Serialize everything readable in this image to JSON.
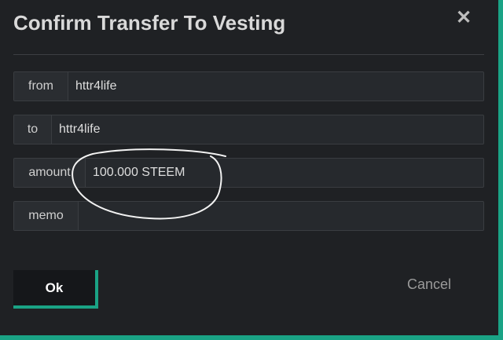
{
  "dialog": {
    "title": "Confirm Transfer To Vesting",
    "close_glyph": "✕"
  },
  "fields": {
    "from": {
      "label": "from",
      "value": "httr4life"
    },
    "to": {
      "label": "to",
      "value": "httr4life"
    },
    "amount": {
      "label": "amount",
      "value": "100.000 STEEM"
    },
    "memo": {
      "label": "memo",
      "value": ""
    }
  },
  "actions": {
    "ok_label": "Ok",
    "cancel_label": "Cancel"
  },
  "colors": {
    "accent": "#1aa385",
    "background": "#1f2124",
    "field_background": "#26292d"
  }
}
